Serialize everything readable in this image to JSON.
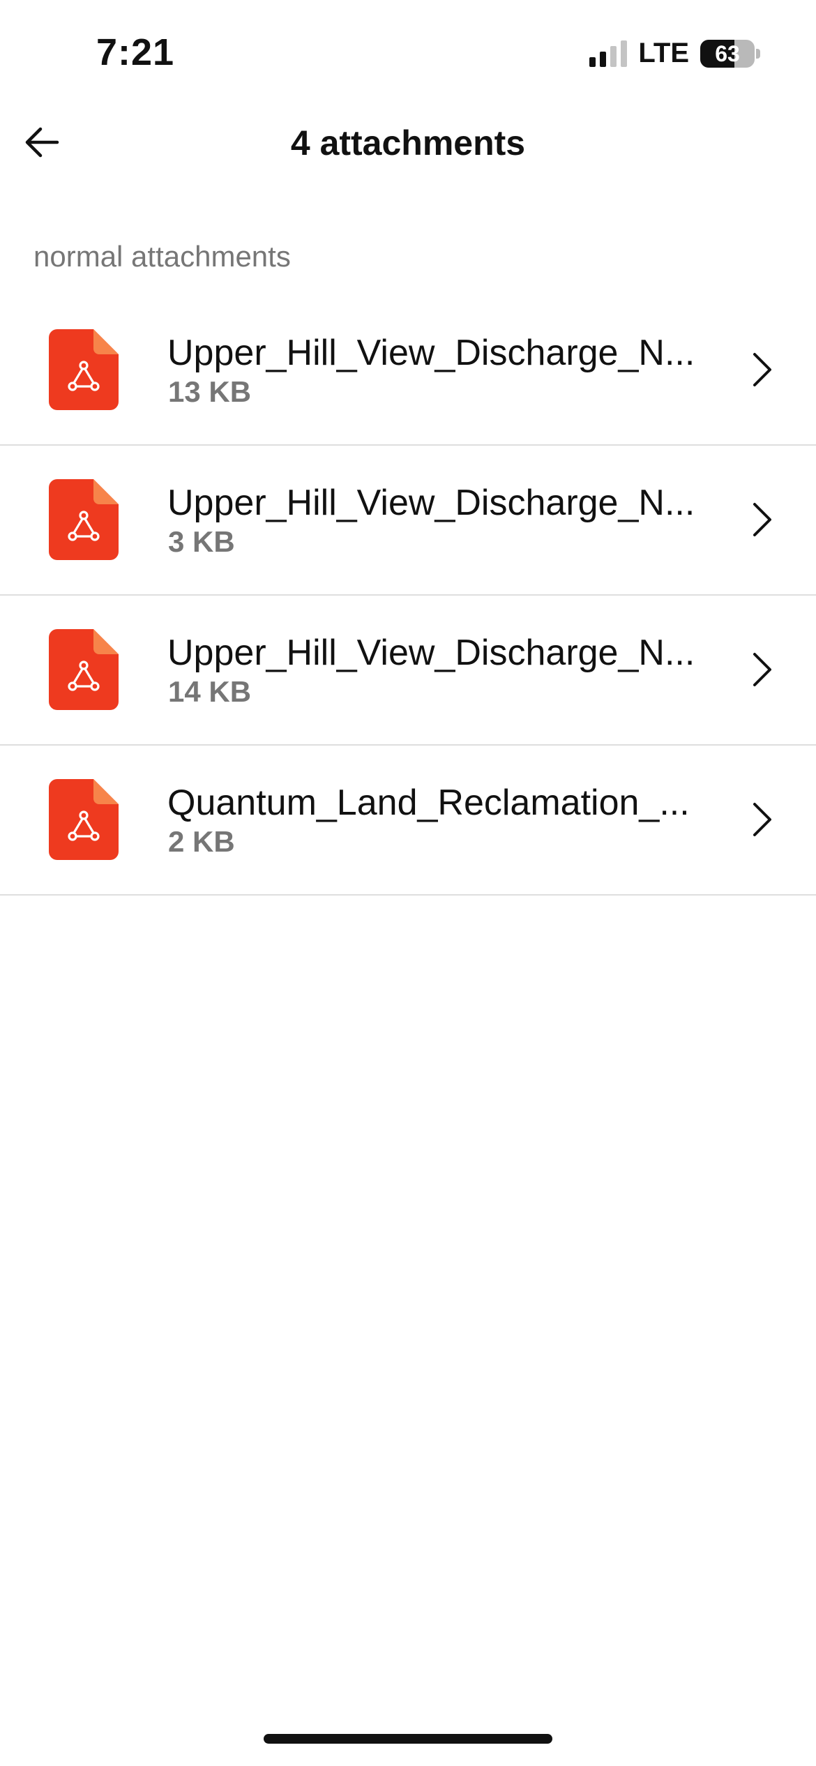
{
  "status_bar": {
    "time": "7:21",
    "network": "LTE",
    "battery_percent": "63",
    "battery_level": 0.63,
    "signal_bars_active": 2,
    "signal_bars_total": 4
  },
  "header": {
    "back_icon": "arrow-left-icon",
    "title": "4 attachments"
  },
  "section": {
    "label": "normal attachments"
  },
  "attachments": [
    {
      "name": "Upper_Hill_View_Discharge_N...",
      "size": "13 KB",
      "icon": "pdf-file-icon"
    },
    {
      "name": "Upper_Hill_View_Discharge_N...",
      "size": "3 KB",
      "icon": "pdf-file-icon"
    },
    {
      "name": "Upper_Hill_View_Discharge_N...",
      "size": "14 KB",
      "icon": "pdf-file-icon"
    },
    {
      "name": "Quantum_Land_Reclamation_...",
      "size": "2 KB",
      "icon": "pdf-file-icon"
    }
  ],
  "colors": {
    "pdf_red": "#EE3A1F",
    "pdf_fold": "#F7844A",
    "secondary_text": "#767676",
    "divider": "#DEDEDE"
  }
}
